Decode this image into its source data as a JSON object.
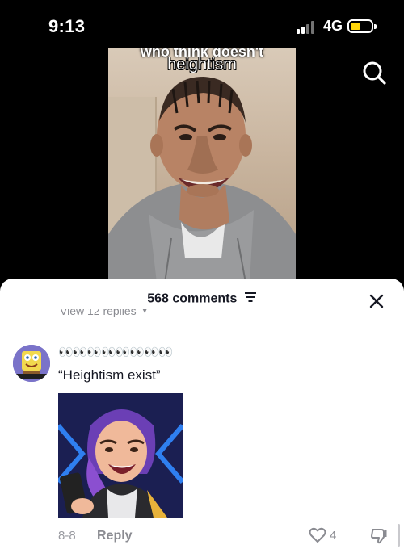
{
  "status_bar": {
    "time": "9:13",
    "network": "4G",
    "battery_level": 0.4,
    "battery_color": "#ffd60a"
  },
  "video": {
    "caption_partial": "who think doesn't",
    "caption": "heightism",
    "search_icon": "search-icon"
  },
  "comments": {
    "count_label": "568 comments",
    "filter_icon": "filter-icon",
    "close_icon": "close-icon",
    "view_replies_label": "View 12 replies",
    "item": {
      "username": "👀👀👀👀👀👀👀👀",
      "text": "“Heightism exist”",
      "date": "8-8",
      "reply_label": "Reply",
      "like_count": "4",
      "like_icon": "heart-icon",
      "dislike_icon": "thumbs-down-icon"
    }
  }
}
